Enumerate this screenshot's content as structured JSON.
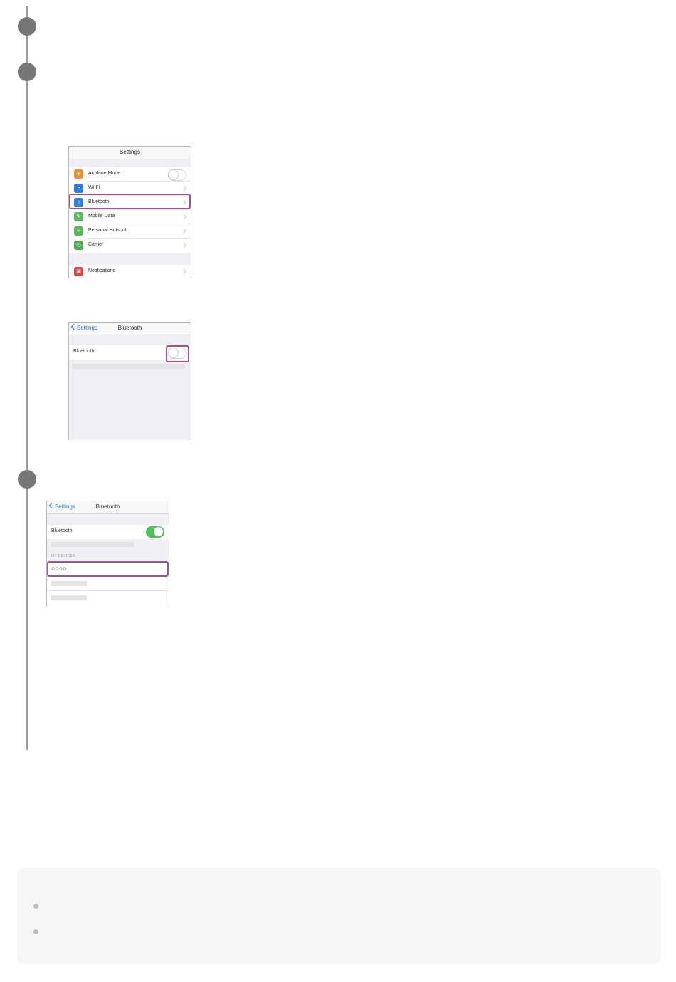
{
  "steps": {
    "icons": [
      "step-circle",
      "step-circle",
      "step-circle"
    ]
  },
  "screen_settings": {
    "title": "Settings",
    "items": [
      {
        "label": "Airplane Mode",
        "icon": "airplane-icon",
        "color": "#f0902c"
      },
      {
        "label": "Wi-Fi",
        "icon": "wifi-icon",
        "color": "#2f7ed8"
      },
      {
        "label": "Bluetooth",
        "icon": "bluetooth-icon",
        "color": "#2f7ed8"
      },
      {
        "label": "Mobile Data",
        "icon": "antenna-icon",
        "color": "#5cb85c"
      },
      {
        "label": "Personal Hotspot",
        "icon": "hotspot-icon",
        "color": "#5cb85c"
      },
      {
        "label": "Carrier",
        "icon": "phone-icon",
        "color": "#4cae4c"
      },
      {
        "label": "Notifications",
        "icon": "notifications-icon",
        "color": "#e04646"
      }
    ]
  },
  "screen_bt_off": {
    "back_label": "Settings",
    "title": "Bluetooth",
    "row_label": "Bluetooth",
    "toggle_on": false
  },
  "screen_bt_on": {
    "back_label": "Settings",
    "title": "Bluetooth",
    "row_label": "Bluetooth",
    "toggle_on": true,
    "section_header": "MY DEVICES",
    "device_name": "○○○○"
  },
  "colors": {
    "highlight": "#a0558e",
    "toggle_on": "#4cc45b",
    "step_dot": "#777777"
  }
}
